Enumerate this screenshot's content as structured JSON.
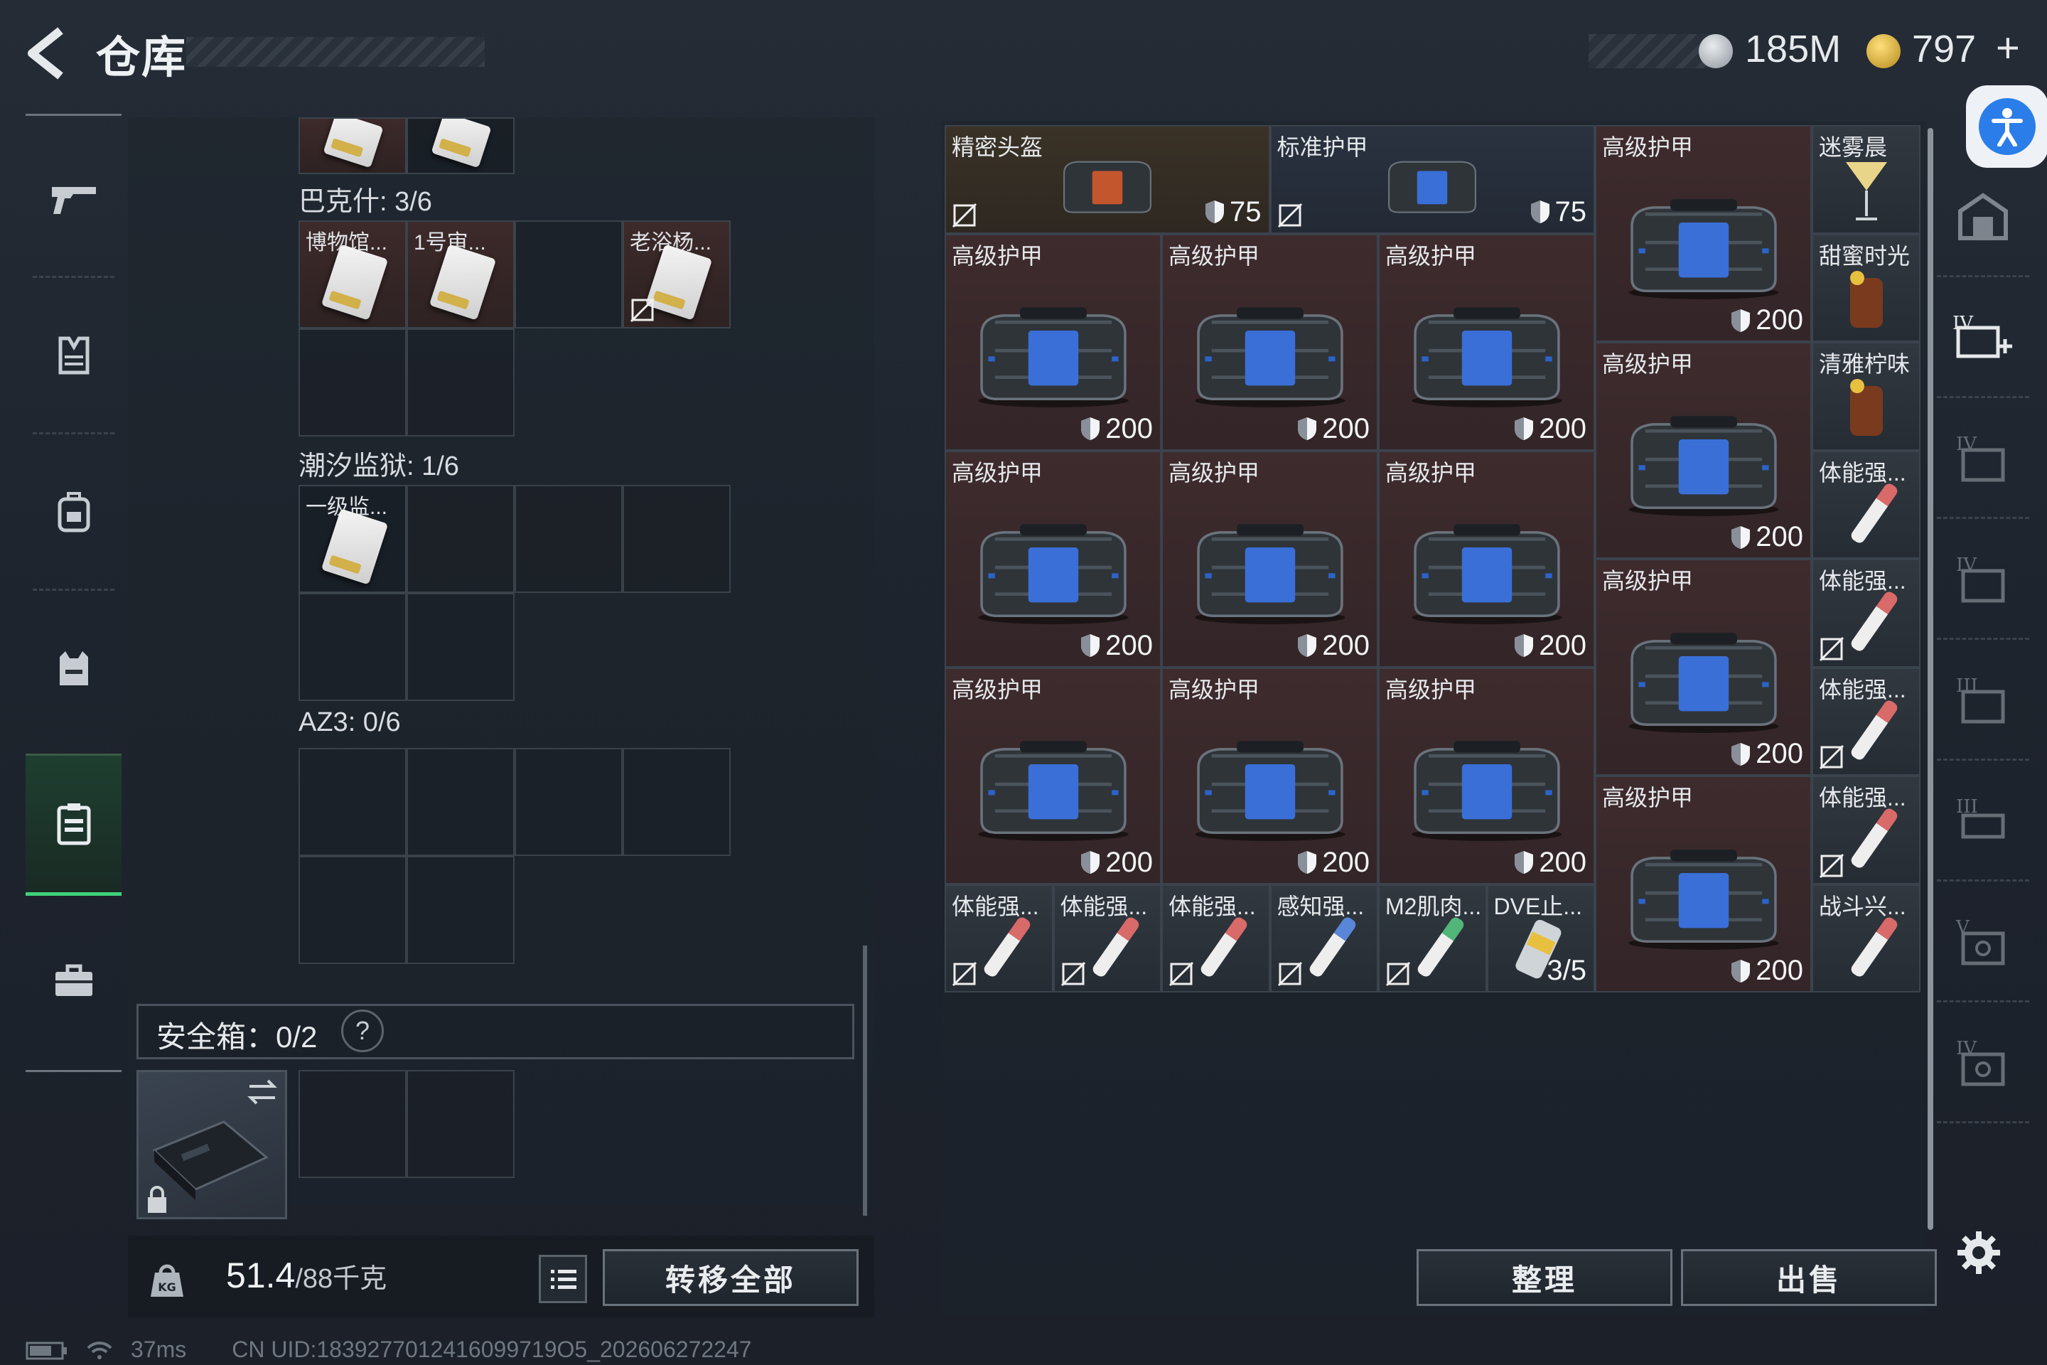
{
  "header": {
    "title": "仓库",
    "currency_1": "185M",
    "currency_2": "797",
    "plus": "+"
  },
  "containers": [
    {
      "label": "巴克什: 3/6",
      "items": [
        "博物馆...",
        "1号审...",
        "",
        "老浴杨..."
      ]
    },
    {
      "label": "潮汐监狱: 1/6",
      "items": [
        "一级监..."
      ]
    },
    {
      "label": "AZ3: 0/6",
      "items": []
    }
  ],
  "safe": {
    "label": "安全箱：0/2",
    "help": "?"
  },
  "footer": {
    "weight_value": "51.4",
    "weight_max": "/88千克",
    "transfer_all": "转移全部",
    "organize": "整理",
    "sell": "出售"
  },
  "status": {
    "ping": "37ms",
    "uid": "CN UID:1839277012416099719O5_202606272247"
  },
  "stash": {
    "top_row": [
      {
        "name": "精密头盔",
        "durability": "75",
        "no_sell": true,
        "bg": "#3a3226"
      },
      {
        "name": "标准护甲",
        "durability": "75",
        "no_sell": true,
        "bg": "#2a3240"
      }
    ],
    "armor_name": "高级护甲",
    "armor_durability": "200",
    "right_col": [
      {
        "name": "迷雾晨"
      },
      {
        "name": "甜蜜时光"
      },
      {
        "name": "清雅柠味"
      },
      {
        "name": "体能强..."
      },
      {
        "name": "体能强..."
      },
      {
        "name": "体能强..."
      },
      {
        "name": "体能强..."
      },
      {
        "name": "战斗兴..."
      }
    ],
    "bottom_row": [
      {
        "name": "体能强...",
        "color": "#d86a6a"
      },
      {
        "name": "体能强...",
        "color": "#d86a6a"
      },
      {
        "name": "体能强...",
        "color": "#d86a6a"
      },
      {
        "name": "感知强...",
        "color": "#5a86d8"
      },
      {
        "name": "M2肌肉...",
        "color": "#52b57a"
      },
      {
        "name": "DVE止...",
        "count": "3/5"
      }
    ]
  },
  "nav": [
    "gun-icon",
    "armor-icon",
    "backpack-icon",
    "chest-rig-icon",
    "container-icon",
    "briefcase-icon"
  ],
  "colors": {
    "accent_green": "#3fd27a",
    "item_red": "#3e2b2d",
    "access_blue": "#2b7de9"
  }
}
